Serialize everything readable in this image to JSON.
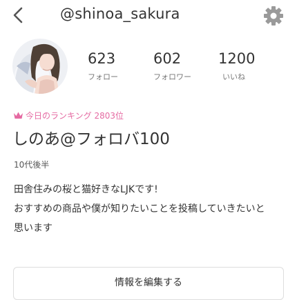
{
  "header": {
    "username": "@shinoa_sakura",
    "back_icon": "chevron-left-icon",
    "settings_icon": "gear-icon"
  },
  "profile": {
    "avatar": "avatar-illustration",
    "stats": [
      {
        "value": "623",
        "label": "フォロー"
      },
      {
        "value": "602",
        "label": "フォロワー"
      },
      {
        "value": "1200",
        "label": "いいね"
      }
    ],
    "ranking": {
      "icon": "crown-icon",
      "text": "今日のランキング 2803位",
      "color": "#e56aa2"
    },
    "display_name": "しのあ@フォロバ100",
    "age": "10代後半",
    "bio_lines": [
      "田舎住みの桜と猫好きなLJKです!",
      "おすすめの商品や僕が知りたいことを投稿していきたいと",
      "思います"
    ]
  },
  "actions": {
    "edit_label": "情報を編集する"
  }
}
